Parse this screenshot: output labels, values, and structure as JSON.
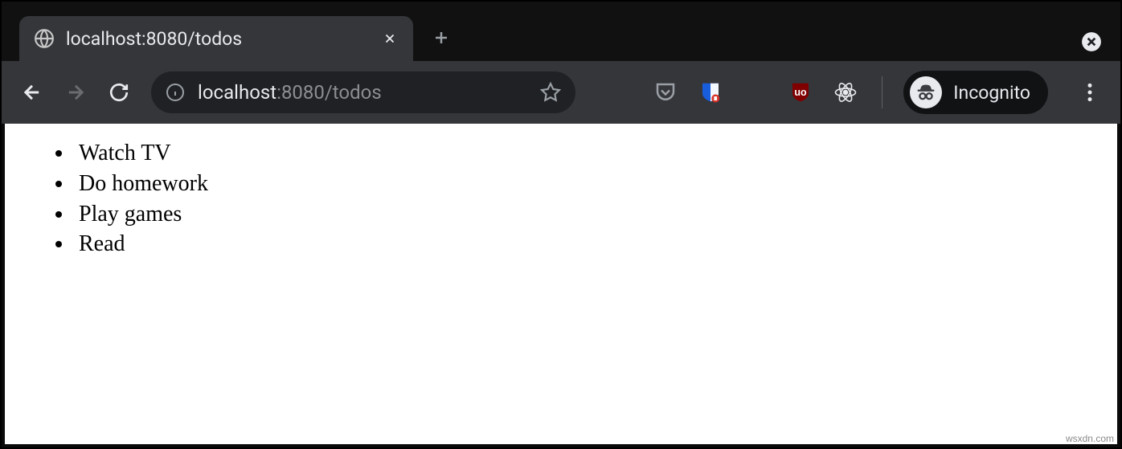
{
  "browser": {
    "tab": {
      "title": "localhost:8080/todos"
    },
    "url": {
      "host": "localhost",
      "rest": ":8080/todos"
    },
    "incognito_label": "Incognito"
  },
  "todos": [
    "Watch TV",
    "Do homework",
    "Play games",
    "Read"
  ],
  "watermark": "wsxdn.com"
}
